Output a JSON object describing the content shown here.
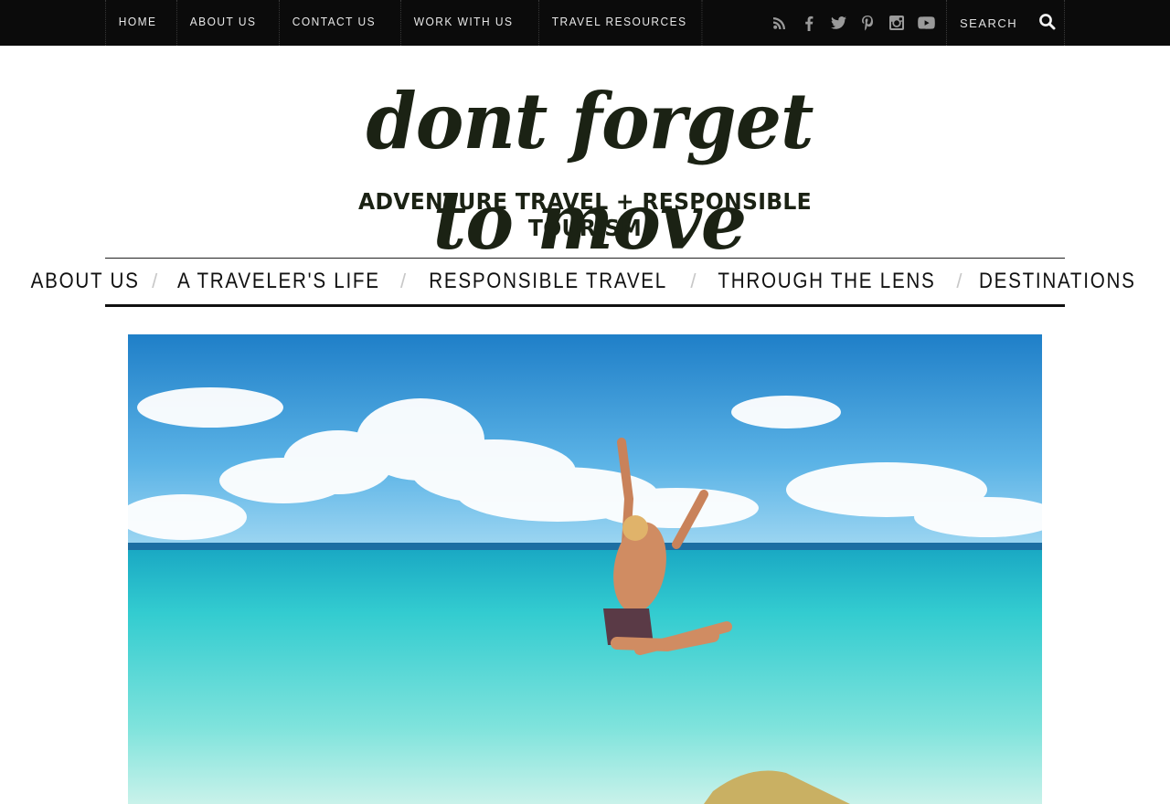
{
  "topnav": {
    "items": [
      "HOME",
      "ABOUT US",
      "CONTACT US",
      "WORK WITH US",
      "TRAVEL RESOURCES"
    ]
  },
  "socials": [
    "rss-icon",
    "facebook-icon",
    "twitter-icon",
    "pinterest-icon",
    "instagram-icon",
    "youtube-icon"
  ],
  "search": {
    "placeholder": "SEARCH"
  },
  "logo": {
    "script": "dont forget to move",
    "tagline": "ADVENTURE TRAVEL + RESPONSIBLE TOURISM"
  },
  "mainnav": {
    "items": [
      "ABOUT US",
      "A TRAVELER'S LIFE",
      "RESPONSIBLE TRAVEL",
      "THROUGH THE LENS",
      "DESTINATIONS"
    ]
  },
  "colors": {
    "topbar": "#0b0b0b",
    "logo": "#1b2214",
    "sea": "#3fd0cf",
    "sky": "#2f8fcf"
  }
}
